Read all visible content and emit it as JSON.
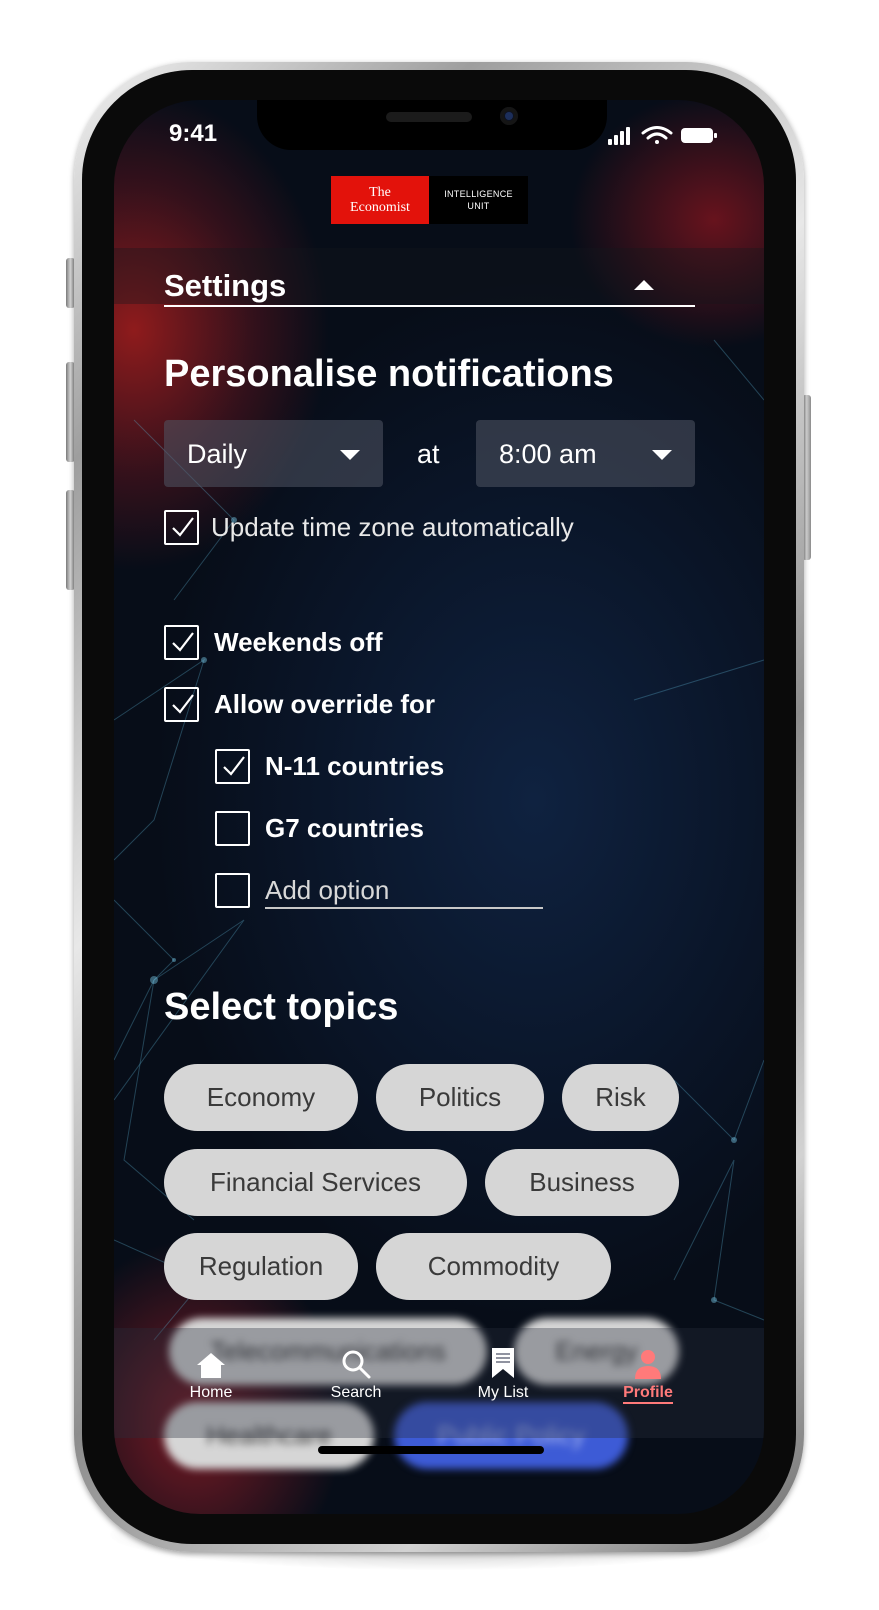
{
  "status_bar": {
    "time": "9:41"
  },
  "logo": {
    "brand_line1": "The",
    "brand_line2": "Economist",
    "unit_line1": "INTELLIGENCE",
    "unit_line2": "UNIT"
  },
  "settings": {
    "title": "Settings"
  },
  "notifications": {
    "heading": "Personalise notifications",
    "frequency": "Daily",
    "at_label": "at",
    "time": "8:00 am",
    "timezone_label": "Update time zone automatically",
    "timezone_checked": true,
    "weekends_label": "Weekends off",
    "weekends_checked": true,
    "override_label": "Allow override for",
    "override_checked": true,
    "override_options": [
      {
        "label": "N-11 countries",
        "checked": true
      },
      {
        "label": "G7 countries",
        "checked": false
      },
      {
        "label": "Add option",
        "checked": false
      }
    ]
  },
  "topics": {
    "heading": "Select topics",
    "chips": [
      "Economy",
      "Politics",
      "Risk",
      "Financial Services",
      "Business",
      "Regulation",
      "Commodity",
      "Telecommunications",
      "Energy",
      "Healthcare",
      "Public Policy"
    ]
  },
  "tabbar": {
    "tabs": [
      {
        "label": "Home",
        "icon": "home-icon"
      },
      {
        "label": "Search",
        "icon": "search-icon"
      },
      {
        "label": "My List",
        "icon": "bookmark-list-icon"
      },
      {
        "label": "Profile",
        "icon": "person-icon"
      }
    ],
    "active": "Profile",
    "active_color": "#ff7a7a"
  },
  "colors": {
    "brand_red": "#e3120b",
    "chip_bg": "#d6d6d6",
    "chip_selected": "#3d5bd6"
  }
}
